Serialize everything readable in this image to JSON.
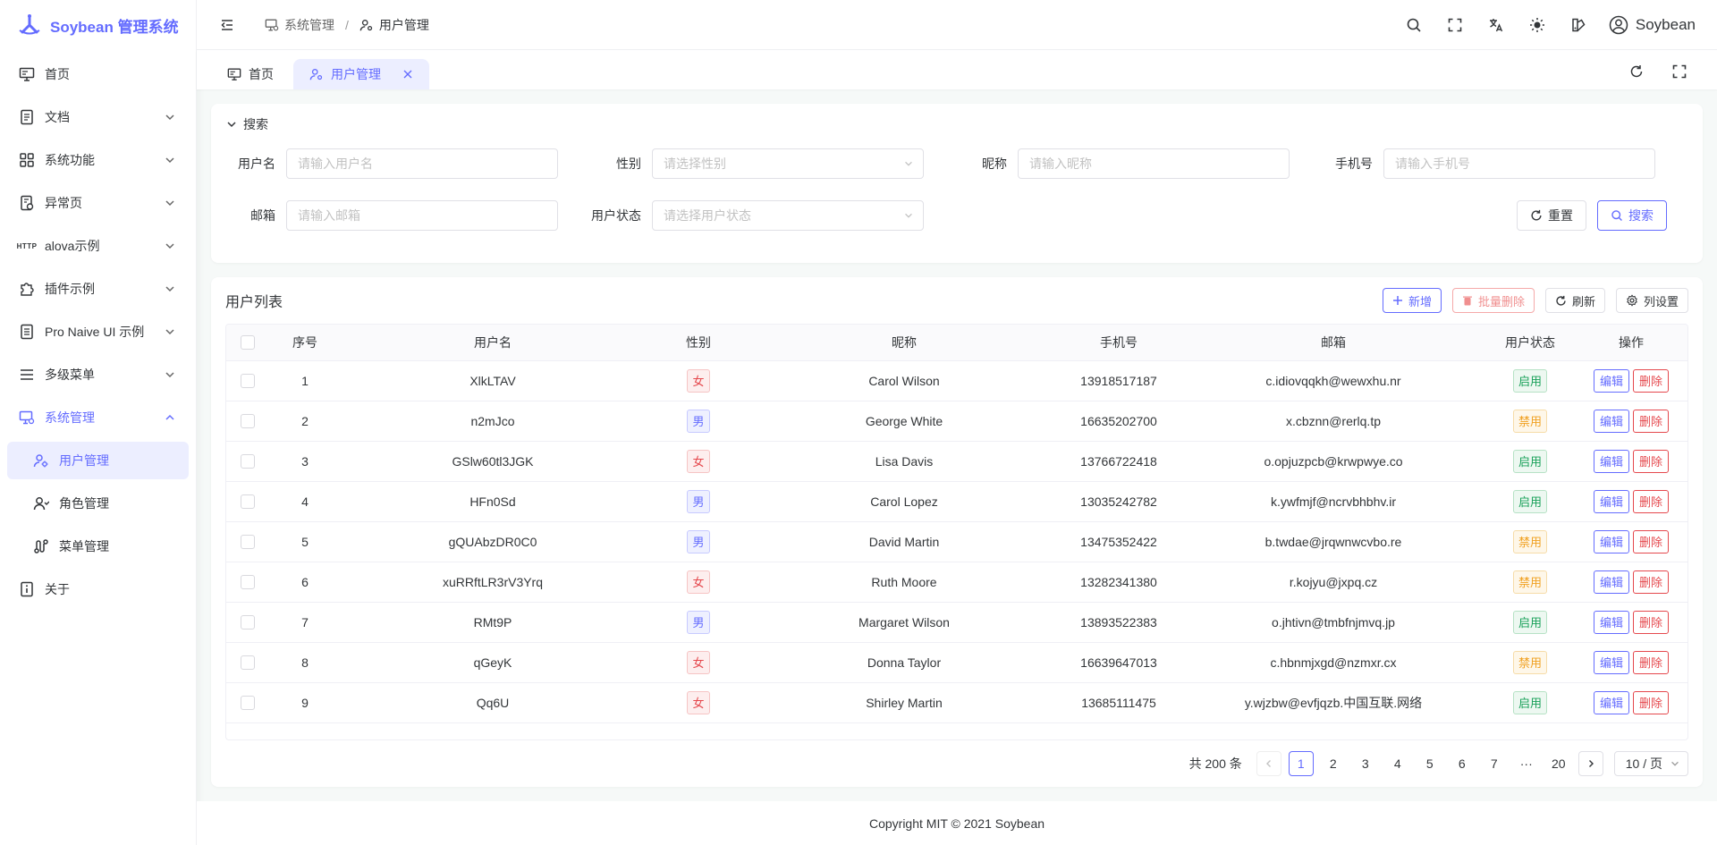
{
  "app": {
    "brand": "Soybean 管理系统",
    "accent": "#646cff"
  },
  "sidebar": {
    "items": [
      {
        "label": "首页",
        "icon": "monitor-icon"
      },
      {
        "label": "文档",
        "icon": "document-icon"
      },
      {
        "label": "系统功能",
        "icon": "grid-icon"
      },
      {
        "label": "异常页",
        "icon": "exception-icon"
      },
      {
        "label": "alova示例",
        "icon": "http-icon",
        "badge": "HTTP"
      },
      {
        "label": "插件示例",
        "icon": "plugin-icon"
      },
      {
        "label": "Pro Naive UI 示例",
        "icon": "doc-list-icon"
      },
      {
        "label": "多级菜单",
        "icon": "menu-lines-icon"
      },
      {
        "label": "系统管理",
        "icon": "system-icon"
      },
      {
        "label": "用户管理",
        "icon": "user-gear-icon"
      },
      {
        "label": "角色管理",
        "icon": "role-icon"
      },
      {
        "label": "菜单管理",
        "icon": "route-icon"
      },
      {
        "label": "关于",
        "icon": "info-icon"
      }
    ]
  },
  "header": {
    "breadcrumb": [
      {
        "label": "系统管理"
      },
      {
        "label": "用户管理"
      }
    ],
    "separator": "/",
    "username": "Soybean"
  },
  "tabs": [
    {
      "label": "首页"
    },
    {
      "label": "用户管理"
    }
  ],
  "search": {
    "title": "搜索",
    "fields": {
      "username": {
        "label": "用户名",
        "placeholder": "请输入用户名"
      },
      "gender": {
        "label": "性别",
        "placeholder": "请选择性别"
      },
      "nickname": {
        "label": "昵称",
        "placeholder": "请输入昵称"
      },
      "phone": {
        "label": "手机号",
        "placeholder": "请输入手机号"
      },
      "email": {
        "label": "邮箱",
        "placeholder": "请输入邮箱"
      },
      "status": {
        "label": "用户状态",
        "placeholder": "请选择用户状态"
      }
    },
    "reset_label": "重置",
    "search_label": "搜索"
  },
  "table": {
    "title": "用户列表",
    "actions": {
      "add": "新增",
      "batch_delete": "批量删除",
      "refresh": "刷新",
      "columns": "列设置"
    },
    "columns": [
      "序号",
      "用户名",
      "性别",
      "昵称",
      "手机号",
      "邮箱",
      "用户状态",
      "操作"
    ],
    "edit_label": "编辑",
    "delete_label": "删除",
    "rows": [
      {
        "index": "1",
        "username": "XlkLTAV",
        "gender": "女",
        "gender_type": "female",
        "nickname": "Carol Wilson",
        "phone": "13918517187",
        "email": "c.idiovqqkh@wewxhu.nr",
        "status": "启用",
        "status_type": "on"
      },
      {
        "index": "2",
        "username": "n2mJco",
        "gender": "男",
        "gender_type": "male",
        "nickname": "George White",
        "phone": "16635202700",
        "email": "x.cbznn@rerlq.tp",
        "status": "禁用",
        "status_type": "off"
      },
      {
        "index": "3",
        "username": "GSlw60tl3JGK",
        "gender": "女",
        "gender_type": "female",
        "nickname": "Lisa Davis",
        "phone": "13766722418",
        "email": "o.opjuzpcb@krwpwye.co",
        "status": "启用",
        "status_type": "on"
      },
      {
        "index": "4",
        "username": "HFn0Sd",
        "gender": "男",
        "gender_type": "male",
        "nickname": "Carol Lopez",
        "phone": "13035242782",
        "email": "k.ywfmjf@ncrvbhbhv.ir",
        "status": "启用",
        "status_type": "on"
      },
      {
        "index": "5",
        "username": "gQUAbzDR0C0",
        "gender": "男",
        "gender_type": "male",
        "nickname": "David Martin",
        "phone": "13475352422",
        "email": "b.twdae@jrqwnwcvbo.re",
        "status": "禁用",
        "status_type": "off"
      },
      {
        "index": "6",
        "username": "xuRRftLR3rV3Yrq",
        "gender": "女",
        "gender_type": "female",
        "nickname": "Ruth Moore",
        "phone": "13282341380",
        "email": "r.kojyu@jxpq.cz",
        "status": "禁用",
        "status_type": "off"
      },
      {
        "index": "7",
        "username": "RMt9P",
        "gender": "男",
        "gender_type": "male",
        "nickname": "Margaret Wilson",
        "phone": "13893522383",
        "email": "o.jhtivn@tmbfnjmvq.jp",
        "status": "启用",
        "status_type": "on"
      },
      {
        "index": "8",
        "username": "qGeyK",
        "gender": "女",
        "gender_type": "female",
        "nickname": "Donna Taylor",
        "phone": "16639647013",
        "email": "c.hbnmjxgd@nzmxr.cx",
        "status": "禁用",
        "status_type": "off"
      },
      {
        "index": "9",
        "username": "Qq6U",
        "gender": "女",
        "gender_type": "female",
        "nickname": "Shirley Martin",
        "phone": "13685111475",
        "email": "y.wjzbw@evfjqzb.中国互联.网络",
        "status": "启用",
        "status_type": "on"
      }
    ]
  },
  "pagination": {
    "total_text": "共 200 条",
    "pages": [
      "1",
      "2",
      "3",
      "4",
      "5",
      "6",
      "7"
    ],
    "ellipsis": "···",
    "last_page": "20",
    "current": "1",
    "page_size": "10 / 页"
  },
  "footer": {
    "copyright": "Copyright MIT © 2021 Soybean"
  }
}
